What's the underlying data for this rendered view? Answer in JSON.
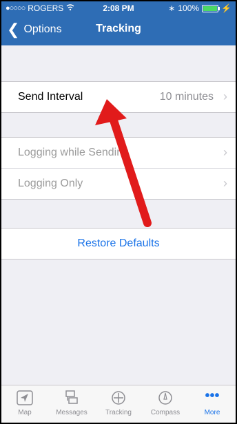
{
  "status": {
    "carrier": "ROGERS",
    "time": "2:08 PM",
    "battery": "100%"
  },
  "nav": {
    "back_label": "Options",
    "title": "Tracking"
  },
  "settings": {
    "group1": [
      {
        "label": "Send Interval",
        "value": "10 minutes",
        "disabled": false
      }
    ],
    "group2": [
      {
        "label": "Logging while Sending",
        "disabled": true
      },
      {
        "label": "Logging Only",
        "disabled": true
      }
    ],
    "restore_label": "Restore Defaults"
  },
  "tabs": [
    {
      "label": "Map",
      "icon": "navigate-arrow-icon",
      "active": false
    },
    {
      "label": "Messages",
      "icon": "messages-icon",
      "active": false
    },
    {
      "label": "Tracking",
      "icon": "crosshair-icon",
      "active": false
    },
    {
      "label": "Compass",
      "icon": "compass-icon",
      "active": false
    },
    {
      "label": "More",
      "icon": "more-dots-icon",
      "active": true
    }
  ],
  "colors": {
    "bar": "#2e6db5",
    "accent": "#1a73e8",
    "annotation_arrow": "#e11b1b"
  }
}
